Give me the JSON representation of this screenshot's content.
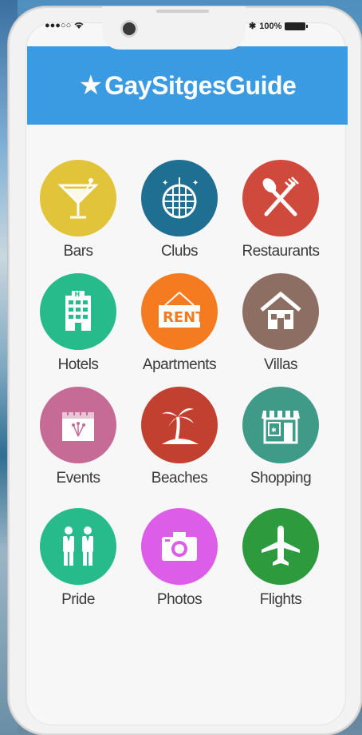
{
  "status_bar": {
    "signal": "●●●○○",
    "wifi_icon": "wifi-icon",
    "bluetooth": "✱",
    "battery_text": "100%"
  },
  "header": {
    "star_icon": "star-icon",
    "title": "GaySitgesGuide",
    "color": "#3a9be3"
  },
  "categories": [
    {
      "label": "Bars",
      "icon": "cocktail-icon",
      "color": "#e2c43a"
    },
    {
      "label": "Clubs",
      "icon": "disco-ball-icon",
      "color": "#1f6f93"
    },
    {
      "label": "Restaurants",
      "icon": "fork-knife-icon",
      "color": "#cf4a3c"
    },
    {
      "label": "Hotels",
      "icon": "hotel-icon",
      "color": "#27ba8a"
    },
    {
      "label": "Apartments",
      "icon": "rent-sign-icon",
      "color": "#f47b1f"
    },
    {
      "label": "Villas",
      "icon": "house-icon",
      "color": "#8d6e63"
    },
    {
      "label": "Events",
      "icon": "calendar-icon",
      "color": "#c56b96"
    },
    {
      "label": "Beaches",
      "icon": "palm-tree-icon",
      "color": "#c2402f"
    },
    {
      "label": "Shopping",
      "icon": "shop-icon",
      "color": "#3f9a88"
    },
    {
      "label": "Pride",
      "icon": "couple-icon",
      "color": "#27ba8a"
    },
    {
      "label": "Photos",
      "icon": "camera-icon",
      "color": "#dc5ee8"
    },
    {
      "label": "Flights",
      "icon": "airplane-icon",
      "color": "#2e9a3e"
    }
  ]
}
